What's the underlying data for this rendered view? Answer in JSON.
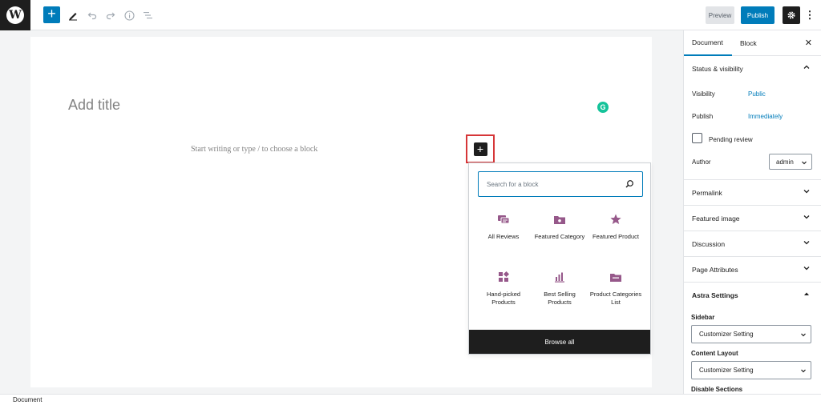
{
  "toolbar": {
    "logo_glyph": "W",
    "add_glyph": "+",
    "preview_label": "Preview",
    "publish_label": "Publish",
    "more_glyph": "⋮"
  },
  "editor": {
    "title_placeholder": "Add title",
    "body_placeholder": "Start writing or type / to choose a block",
    "grammarly_glyph": "G",
    "inserter_glyph": "+"
  },
  "inserter": {
    "search_placeholder": "Search for a block",
    "blocks": [
      {
        "label": "All Reviews",
        "icon": "reviews-icon"
      },
      {
        "label": "Featured Category",
        "icon": "folder-star-icon"
      },
      {
        "label": "Featured Product",
        "icon": "star-icon"
      },
      {
        "label": "Hand-picked Products",
        "icon": "grid-icon"
      },
      {
        "label": "Best Selling Products",
        "icon": "bar-chart-icon"
      },
      {
        "label": "Product Categories List",
        "icon": "folder-list-icon"
      }
    ],
    "browse_all_label": "Browse all",
    "icon_color": "#96588a"
  },
  "sidebar": {
    "tabs": [
      "Document",
      "Block"
    ],
    "close_glyph": "✕",
    "status_visibility": "Status & visibility",
    "visibility_label": "Visibility",
    "visibility_value": "Public",
    "publish_label": "Publish",
    "publish_value": "Immediately",
    "pending_review": "Pending review",
    "author_label": "Author",
    "author_value": "admin",
    "panels": [
      "Permalink",
      "Featured image",
      "Discussion",
      "Page Attributes"
    ],
    "astra_settings": "Astra Settings",
    "sidebar_label": "Sidebar",
    "sidebar_value": "Customizer Setting",
    "content_layout_label": "Content Layout",
    "content_layout_value": "Customizer Setting",
    "disable_sections_label": "Disable Sections"
  },
  "footer": {
    "breadcrumb": "Document"
  },
  "colors": {
    "accent": "#007cba",
    "dark": "#1e1e1e",
    "highlight_border": "#d63638"
  }
}
